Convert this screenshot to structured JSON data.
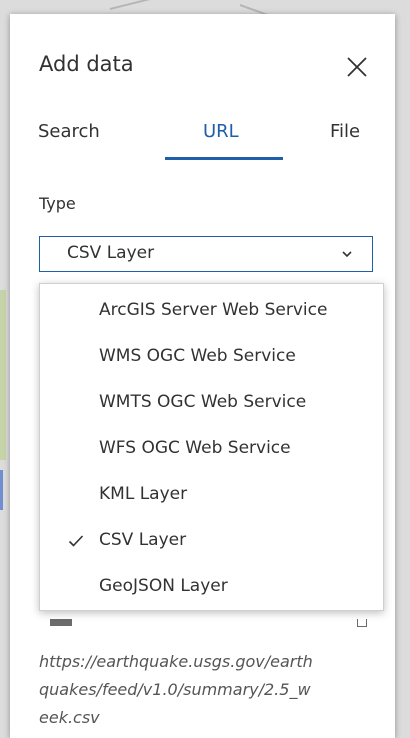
{
  "panel": {
    "title": "Add data",
    "close_icon": "close-icon"
  },
  "tabs": [
    {
      "label": "Search"
    },
    {
      "label": "URL",
      "active": true
    },
    {
      "label": "File"
    }
  ],
  "type": {
    "label": "Type",
    "selected": "CSV Layer",
    "chevron_icon": "chevron-down-icon",
    "options": [
      {
        "label": "ArcGIS Server Web Service"
      },
      {
        "label": "WMS OGC Web Service"
      },
      {
        "label": "WMTS OGC Web Service"
      },
      {
        "label": "WFS OGC Web Service"
      },
      {
        "label": "KML Layer"
      },
      {
        "label": "CSV Layer",
        "checked": true
      },
      {
        "label": "GeoJSON Layer"
      }
    ]
  },
  "url_value_lines": [
    "https://earthquake.usgs.gov/earth",
    "quakes/feed/v1.0/summary/2.5_w",
    "eek.csv"
  ],
  "colors": {
    "accent": "#1f5ea8",
    "text": "#323232"
  }
}
